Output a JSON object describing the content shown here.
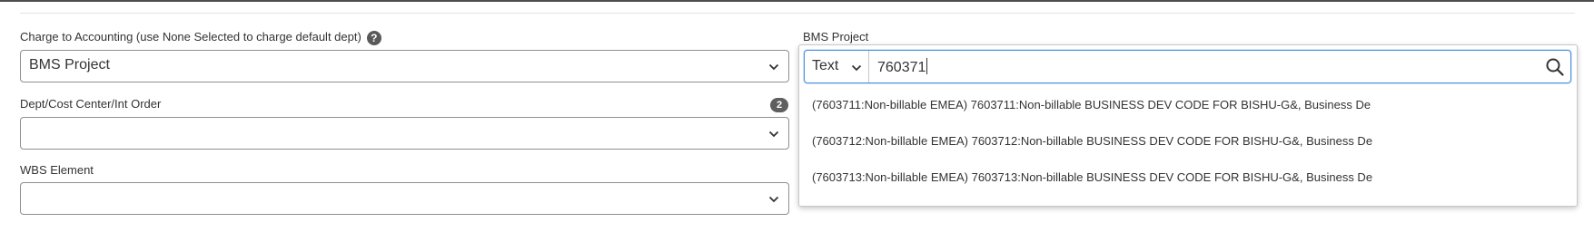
{
  "charge_to_accounting": {
    "label": "Charge to Accounting (use None Selected to charge default dept)",
    "help_icon": "?",
    "value": "BMS Project"
  },
  "dept_cost_center": {
    "label": "Dept/Cost Center/Int Order",
    "badge": "2",
    "value": ""
  },
  "wbs_element": {
    "label": "WBS Element",
    "value": ""
  },
  "bms_project": {
    "label": "BMS Project",
    "search_type": "Text",
    "search_value": "760371",
    "results": [
      "(7603711:Non-billable EMEA) 7603711:Non-billable BUSINESS DEV CODE FOR BISHU-G&, Business De",
      "(7603712:Non-billable EMEA) 7603712:Non-billable BUSINESS DEV CODE FOR BISHU-G&, Business De",
      "(7603713:Non-billable EMEA) 7603713:Non-billable BUSINESS DEV CODE FOR BISHU-G&, Business De"
    ]
  },
  "icons": {
    "help": "question-circle-icon",
    "dropdown": "chevron-down-icon",
    "search": "magnifier-search-icon"
  },
  "colors": {
    "focus_border": "#4a90e2",
    "badge_bg": "#5f5f5f",
    "field_border": "#8f8f8f",
    "top_bar": "#4d4d4d"
  }
}
